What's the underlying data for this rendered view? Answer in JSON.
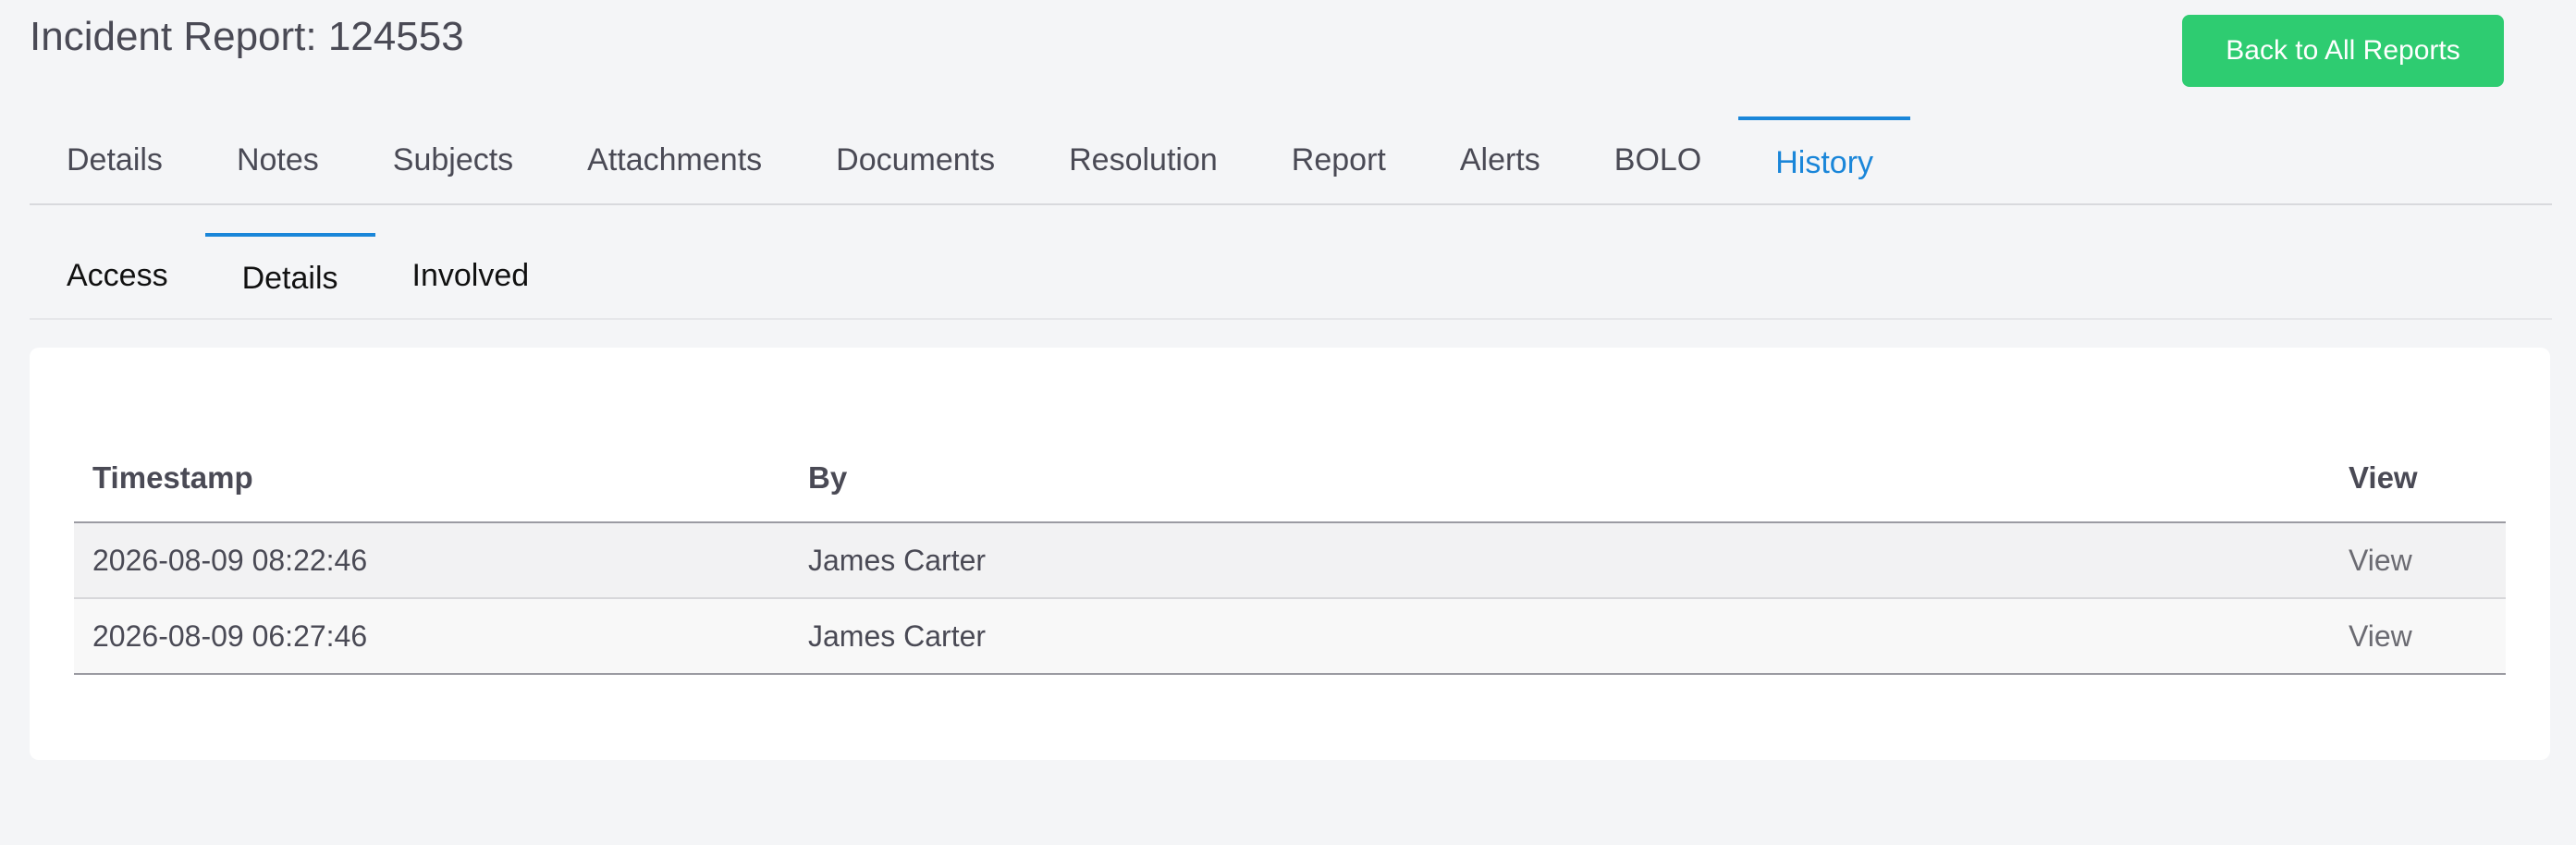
{
  "header": {
    "title": "Incident Report: 124553",
    "back_button_label": "Back to All Reports"
  },
  "colors": {
    "accent": "#1a86d9",
    "success": "#2ecc71"
  },
  "main_tabs": [
    {
      "label": "Details",
      "active": false
    },
    {
      "label": "Notes",
      "active": false
    },
    {
      "label": "Subjects",
      "active": false
    },
    {
      "label": "Attachments",
      "active": false
    },
    {
      "label": "Documents",
      "active": false
    },
    {
      "label": "Resolution",
      "active": false
    },
    {
      "label": "Report",
      "active": false
    },
    {
      "label": "Alerts",
      "active": false
    },
    {
      "label": "BOLO",
      "active": false
    },
    {
      "label": "History",
      "active": true
    }
  ],
  "sub_tabs": [
    {
      "label": "Access",
      "active": false
    },
    {
      "label": "Details",
      "active": true
    },
    {
      "label": "Involved",
      "active": false
    }
  ],
  "table": {
    "columns": [
      "Timestamp",
      "By",
      "View"
    ],
    "rows": [
      {
        "timestamp": "2026-08-09 08:22:46",
        "by": "James Carter",
        "view": "View"
      },
      {
        "timestamp": "2026-08-09 06:27:46",
        "by": "James Carter",
        "view": "View"
      }
    ]
  }
}
